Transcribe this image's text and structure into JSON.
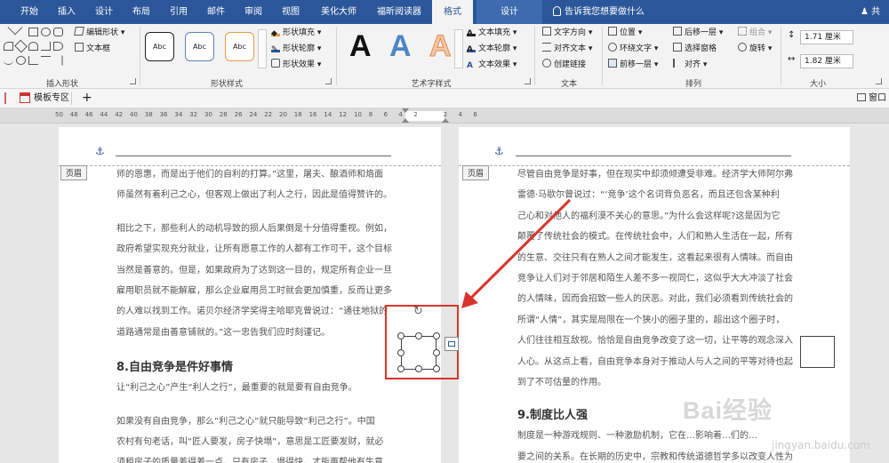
{
  "tabs": [
    "开始",
    "插入",
    "设计",
    "布局",
    "引用",
    "邮件",
    "审阅",
    "视图",
    "美化大师",
    "福昕阅读器",
    "格式",
    "设计"
  ],
  "tell_me": "告诉我您想要做什么",
  "share": "共享",
  "ribbon": {
    "insert_shapes": {
      "edit_shape": "编辑形状",
      "textbox": "文本框",
      "label": "插入形状"
    },
    "shape_styles": {
      "gallery": [
        "Abc",
        "Abc",
        "Abc"
      ],
      "fill": "形状填充",
      "outline": "形状轮廓",
      "effects": "形状效果",
      "label": "形状样式"
    },
    "wordart": {
      "letters": [
        "A",
        "A",
        "A"
      ],
      "text_fill": "文本填充",
      "text_outline": "文本轮廓",
      "text_effects": "文本效果",
      "label": "艺术字样式"
    },
    "text": {
      "direction": "文字方向",
      "align": "对齐文本",
      "link": "创建链接",
      "label": "文本"
    },
    "arrange": {
      "position": "位置",
      "wrap": "环绕文字",
      "forward": "前移一层",
      "backward": "后移一层",
      "selection_pane": "选择窗格",
      "align": "对齐",
      "group": "组合",
      "rotate": "旋转",
      "label": "排列"
    },
    "size": {
      "height": "1.71 厘米",
      "width": "1.82 厘米",
      "label": "大小"
    }
  },
  "template_bar": {
    "item": "模板专区",
    "add": "+",
    "window": "窗口"
  },
  "ruler": {
    "ticks": [
      "50",
      "48",
      "46",
      "44",
      "42",
      "40",
      "38",
      "36",
      "34",
      "32",
      "30",
      "28",
      "26",
      "24",
      "22",
      "20",
      "18",
      "16",
      "14",
      "12",
      "10",
      "8",
      "6",
      "4",
      "2",
      "",
      "2",
      "4",
      "6"
    ]
  },
  "left_page": {
    "header_tag": "页眉",
    "lines": [
      "师的恩惠，而是出于他们的自利的打算。”这里，屠夫、酿酒师和烙面",
      "师虽然有着利己之心，但客观上做出了利人之行，因此是值得赞许的。",
      "",
      "相比之下，那些利人的动机导致的损人后果倒是十分值得重视。例如，",
      "政府希望实现充分就业，让所有愿意工作的人都有工作可干，这个目标",
      "当然是善意的。但是，如果政府为了达到这一目的，规定所有企业一旦",
      "雇用职员就不能解雇，那么企业雇用员工时就会更加慎重，反而让更多",
      "的人难以找到工作。诺贝尔经济学奖得主哈耶克曾说过：“通往地狱的",
      "道路通常是由善意铺就的。”这一忠告我们应时刻谨记。"
    ],
    "heading": "8.自由竞争是件好事情",
    "after_heading": [
      "让“利己之心”产生“利人之行”，最重要的就是要有自由竞争。",
      "",
      "如果没有自由竞争，那么“利己之心”就只能导致“利己之行”。中国",
      "农村有句老话，叫“匠人要发，房子快塌”，意思是工匠要发财，就必",
      "须租房子的质量差得差一点，只有房子…塌得快，才能再帮他有生意"
    ]
  },
  "right_page": {
    "header_tag": "页眉",
    "lines": [
      "尽管自由竞争是好事，但在现实中却须倾遭受非难。经济学大师阿尔弗",
      "雷德·马歇尔曾说过：“‘竞争’这个名词背负恶名，而且还包含某种利",
      "己心和对他人的福利漠不关心的意思。”为什么会这样呢?这是因为它",
      "颠覆了传统社会的模式。在传统社会中，人们和熟人生活在一起，所有",
      "的生意、交往只有在熟人之间才能发生，这看起来很有人情味。而自由",
      "竞争让人们对于邻居和陌生人差不多一视同仁，这似乎大大冲淡了社会",
      "的人情味，因而会招致一些人的厌恶。对此，我们必须看到传统社会的",
      "所谓“人情”，其实是局限在一个狭小的圈子里的，超出这个圈子时，",
      "人们往往相互敌视。恰恰是自由竞争改变了这一切，让平等的观念深入",
      "人心。从这点上看，自由竞争本身对于推动人与人之间的平等对待也起",
      "到了不可估量的作用。"
    ],
    "heading": "9.制度比人强",
    "after_heading": [
      "制度是一种游戏规则、一种激励机制，它在…影响着…们的…",
      "要之间的关系。在长期的历史中，宗教和传统道德哲学多以改变人性为"
    ]
  },
  "watermark": {
    "brand": "Bai经验",
    "url": "jingyan.baidu.com"
  },
  "colors": {
    "title_bar": "#2b579a",
    "annotation_red": "#d9342b",
    "ribbon_bg": "#f3f3f3"
  }
}
